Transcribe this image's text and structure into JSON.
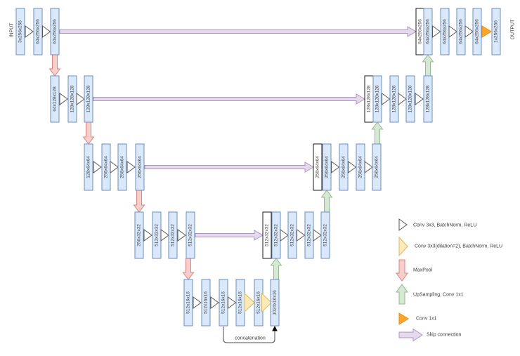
{
  "input_label": "INPUT",
  "output_label": "OUTPUT",
  "concatenation_label": "concatenation",
  "network": {
    "levels": [
      {
        "encoder_blocks": [
          "3x256x256",
          "64x256x256",
          "64x256x256"
        ],
        "concat_block": "64x256x256",
        "decoder_blocks": [
          "64x256x256",
          "64x256x256",
          "64x256x256",
          "64x256x256"
        ],
        "output_block": "1x256x256"
      },
      {
        "encoder_blocks": [
          "64x128x128",
          "128x128x128",
          "128x128x128"
        ],
        "concat_block": "128x128x128",
        "decoder_blocks": [
          "128x128x128",
          "128x128x128",
          "128x128x128",
          "128x128x128"
        ]
      },
      {
        "encoder_blocks": [
          "128x64x64",
          "256x64x64",
          "256x64x64",
          "256x64x64"
        ],
        "concat_block": "256x64x64",
        "decoder_blocks": [
          "256x64x64",
          "256x64x64",
          "256x64x64",
          "256x64x64"
        ]
      },
      {
        "encoder_blocks": [
          "256x32x32",
          "512x32x32",
          "512x32x32",
          "512x32x32"
        ],
        "concat_block": "512x32x32",
        "decoder_blocks": [
          "512x32x32",
          "512x32x32",
          "512x32x32",
          "512x32x32"
        ]
      },
      {
        "bottleneck_blocks": [
          "512x16x16",
          "512x16x16",
          "512x16x16",
          "512x16x16",
          "512x16x16",
          "1024x16x16"
        ]
      }
    ]
  },
  "legend": {
    "items": [
      {
        "icon": "conv3x3-triangle-icon",
        "label": "Conv 3x3, BatchNorm, ReLU"
      },
      {
        "icon": "dilated-conv-triangle-icon",
        "label": "Conv 3x3(dilation=2), BatchNorm, ReLU"
      },
      {
        "icon": "maxpool-arrow-icon",
        "label": "MaxPool"
      },
      {
        "icon": "upsampling-arrow-icon",
        "label": "UpSampling, Conv 1x1"
      },
      {
        "icon": "conv1x1-triangle-icon",
        "label": "Conv 1x1"
      },
      {
        "icon": "skip-connection-arrow-icon",
        "label": "Skip connection"
      }
    ]
  },
  "colors": {
    "block_fill": "#dae8fc",
    "block_stroke": "#6c8ebf",
    "concat_fill": "#ffffff",
    "concat_stroke": "#1a1a1a",
    "conv_triangle_fill": "#ffffff",
    "conv_triangle_stroke": "#565656",
    "dilated_triangle_fill": "#fdeab5",
    "dilated_triangle_stroke": "#ddb862",
    "maxpool_fill": "#f8cecc",
    "maxpool_stroke": "#e0837a",
    "upsample_fill": "#d5e8d4",
    "upsample_stroke": "#93bd8a",
    "conv1x1_fill": "#ffa629",
    "conv1x1_stroke": "#ea8d10",
    "skip_fill": "#e5d9ec",
    "skip_stroke": "#b094c6",
    "concat_line": "#4d4d4d",
    "text": "#3f3f3f"
  }
}
